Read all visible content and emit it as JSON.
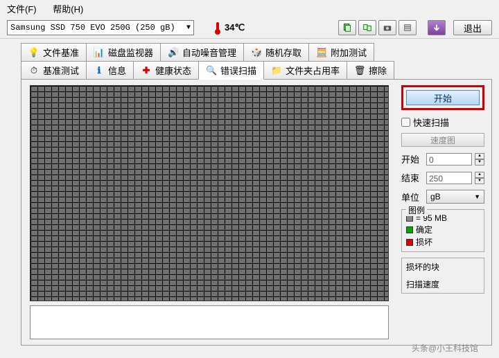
{
  "menu": {
    "file": "文件(F)",
    "help": "帮助(H)"
  },
  "drive": "Samsung SSD 750 EVO 250G (250 gB)",
  "temp": "34℃",
  "exit": "退出",
  "tabs_row1": [
    {
      "label": "文件基准",
      "icon": "bulb"
    },
    {
      "label": "磁盘监视器",
      "icon": "monitor"
    },
    {
      "label": "自动噪音管理",
      "icon": "speaker"
    },
    {
      "label": "随机存取",
      "icon": "dice"
    },
    {
      "label": "附加测试",
      "icon": "calc"
    }
  ],
  "tabs_row2": [
    {
      "label": "基准测试",
      "icon": "gauge"
    },
    {
      "label": "信息",
      "icon": "info"
    },
    {
      "label": "健康状态",
      "icon": "health"
    },
    {
      "label": "错误扫描",
      "icon": "search",
      "active": true
    },
    {
      "label": "文件夹占用率",
      "icon": "folder"
    },
    {
      "label": "擦除",
      "icon": "trash"
    }
  ],
  "side": {
    "start": "开始",
    "quick_scan": "快速扫描",
    "speed_map": "速度图",
    "start_label": "开始",
    "start_val": "0",
    "end_label": "结束",
    "end_val": "250",
    "unit_label": "单位",
    "unit_val": "gB",
    "legend_title": "图例",
    "legend_block": "= 95 MB",
    "legend_ok": "确定",
    "legend_bad": "损坏",
    "damaged_blocks": "损坏的块",
    "scan_speed": "扫描速度"
  },
  "watermark": "头条@小王科技馆"
}
